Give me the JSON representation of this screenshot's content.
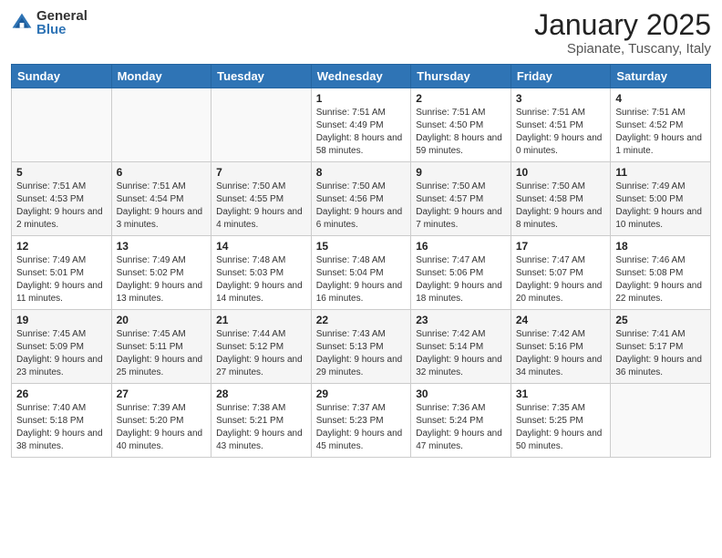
{
  "header": {
    "logo_general": "General",
    "logo_blue": "Blue",
    "month_title": "January 2025",
    "location": "Spianate, Tuscany, Italy"
  },
  "weekdays": [
    "Sunday",
    "Monday",
    "Tuesday",
    "Wednesday",
    "Thursday",
    "Friday",
    "Saturday"
  ],
  "weeks": [
    [
      {
        "day": "",
        "sunrise": "",
        "sunset": "",
        "daylight": ""
      },
      {
        "day": "",
        "sunrise": "",
        "sunset": "",
        "daylight": ""
      },
      {
        "day": "",
        "sunrise": "",
        "sunset": "",
        "daylight": ""
      },
      {
        "day": "1",
        "sunrise": "Sunrise: 7:51 AM",
        "sunset": "Sunset: 4:49 PM",
        "daylight": "Daylight: 8 hours and 58 minutes."
      },
      {
        "day": "2",
        "sunrise": "Sunrise: 7:51 AM",
        "sunset": "Sunset: 4:50 PM",
        "daylight": "Daylight: 8 hours and 59 minutes."
      },
      {
        "day": "3",
        "sunrise": "Sunrise: 7:51 AM",
        "sunset": "Sunset: 4:51 PM",
        "daylight": "Daylight: 9 hours and 0 minutes."
      },
      {
        "day": "4",
        "sunrise": "Sunrise: 7:51 AM",
        "sunset": "Sunset: 4:52 PM",
        "daylight": "Daylight: 9 hours and 1 minute."
      }
    ],
    [
      {
        "day": "5",
        "sunrise": "Sunrise: 7:51 AM",
        "sunset": "Sunset: 4:53 PM",
        "daylight": "Daylight: 9 hours and 2 minutes."
      },
      {
        "day": "6",
        "sunrise": "Sunrise: 7:51 AM",
        "sunset": "Sunset: 4:54 PM",
        "daylight": "Daylight: 9 hours and 3 minutes."
      },
      {
        "day": "7",
        "sunrise": "Sunrise: 7:50 AM",
        "sunset": "Sunset: 4:55 PM",
        "daylight": "Daylight: 9 hours and 4 minutes."
      },
      {
        "day": "8",
        "sunrise": "Sunrise: 7:50 AM",
        "sunset": "Sunset: 4:56 PM",
        "daylight": "Daylight: 9 hours and 6 minutes."
      },
      {
        "day": "9",
        "sunrise": "Sunrise: 7:50 AM",
        "sunset": "Sunset: 4:57 PM",
        "daylight": "Daylight: 9 hours and 7 minutes."
      },
      {
        "day": "10",
        "sunrise": "Sunrise: 7:50 AM",
        "sunset": "Sunset: 4:58 PM",
        "daylight": "Daylight: 9 hours and 8 minutes."
      },
      {
        "day": "11",
        "sunrise": "Sunrise: 7:49 AM",
        "sunset": "Sunset: 5:00 PM",
        "daylight": "Daylight: 9 hours and 10 minutes."
      }
    ],
    [
      {
        "day": "12",
        "sunrise": "Sunrise: 7:49 AM",
        "sunset": "Sunset: 5:01 PM",
        "daylight": "Daylight: 9 hours and 11 minutes."
      },
      {
        "day": "13",
        "sunrise": "Sunrise: 7:49 AM",
        "sunset": "Sunset: 5:02 PM",
        "daylight": "Daylight: 9 hours and 13 minutes."
      },
      {
        "day": "14",
        "sunrise": "Sunrise: 7:48 AM",
        "sunset": "Sunset: 5:03 PM",
        "daylight": "Daylight: 9 hours and 14 minutes."
      },
      {
        "day": "15",
        "sunrise": "Sunrise: 7:48 AM",
        "sunset": "Sunset: 5:04 PM",
        "daylight": "Daylight: 9 hours and 16 minutes."
      },
      {
        "day": "16",
        "sunrise": "Sunrise: 7:47 AM",
        "sunset": "Sunset: 5:06 PM",
        "daylight": "Daylight: 9 hours and 18 minutes."
      },
      {
        "day": "17",
        "sunrise": "Sunrise: 7:47 AM",
        "sunset": "Sunset: 5:07 PM",
        "daylight": "Daylight: 9 hours and 20 minutes."
      },
      {
        "day": "18",
        "sunrise": "Sunrise: 7:46 AM",
        "sunset": "Sunset: 5:08 PM",
        "daylight": "Daylight: 9 hours and 22 minutes."
      }
    ],
    [
      {
        "day": "19",
        "sunrise": "Sunrise: 7:45 AM",
        "sunset": "Sunset: 5:09 PM",
        "daylight": "Daylight: 9 hours and 23 minutes."
      },
      {
        "day": "20",
        "sunrise": "Sunrise: 7:45 AM",
        "sunset": "Sunset: 5:11 PM",
        "daylight": "Daylight: 9 hours and 25 minutes."
      },
      {
        "day": "21",
        "sunrise": "Sunrise: 7:44 AM",
        "sunset": "Sunset: 5:12 PM",
        "daylight": "Daylight: 9 hours and 27 minutes."
      },
      {
        "day": "22",
        "sunrise": "Sunrise: 7:43 AM",
        "sunset": "Sunset: 5:13 PM",
        "daylight": "Daylight: 9 hours and 29 minutes."
      },
      {
        "day": "23",
        "sunrise": "Sunrise: 7:42 AM",
        "sunset": "Sunset: 5:14 PM",
        "daylight": "Daylight: 9 hours and 32 minutes."
      },
      {
        "day": "24",
        "sunrise": "Sunrise: 7:42 AM",
        "sunset": "Sunset: 5:16 PM",
        "daylight": "Daylight: 9 hours and 34 minutes."
      },
      {
        "day": "25",
        "sunrise": "Sunrise: 7:41 AM",
        "sunset": "Sunset: 5:17 PM",
        "daylight": "Daylight: 9 hours and 36 minutes."
      }
    ],
    [
      {
        "day": "26",
        "sunrise": "Sunrise: 7:40 AM",
        "sunset": "Sunset: 5:18 PM",
        "daylight": "Daylight: 9 hours and 38 minutes."
      },
      {
        "day": "27",
        "sunrise": "Sunrise: 7:39 AM",
        "sunset": "Sunset: 5:20 PM",
        "daylight": "Daylight: 9 hours and 40 minutes."
      },
      {
        "day": "28",
        "sunrise": "Sunrise: 7:38 AM",
        "sunset": "Sunset: 5:21 PM",
        "daylight": "Daylight: 9 hours and 43 minutes."
      },
      {
        "day": "29",
        "sunrise": "Sunrise: 7:37 AM",
        "sunset": "Sunset: 5:23 PM",
        "daylight": "Daylight: 9 hours and 45 minutes."
      },
      {
        "day": "30",
        "sunrise": "Sunrise: 7:36 AM",
        "sunset": "Sunset: 5:24 PM",
        "daylight": "Daylight: 9 hours and 47 minutes."
      },
      {
        "day": "31",
        "sunrise": "Sunrise: 7:35 AM",
        "sunset": "Sunset: 5:25 PM",
        "daylight": "Daylight: 9 hours and 50 minutes."
      },
      {
        "day": "",
        "sunrise": "",
        "sunset": "",
        "daylight": ""
      }
    ]
  ]
}
